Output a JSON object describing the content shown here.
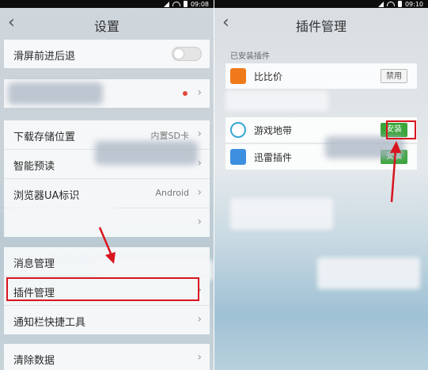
{
  "left": {
    "status_time": "09:08",
    "title": "设置",
    "back_glyph": "‹",
    "items": {
      "swipe": "滑屏前进后退",
      "download_location": "下载存储位置",
      "download_location_value": "内置SD卡",
      "smart_preread": "智能预读",
      "ua": "浏览器UA标识",
      "ua_value": "Android",
      "messages": "消息管理",
      "plugins": "插件管理",
      "notification_tool": "通知栏快捷工具",
      "clear_data": "清除数据"
    }
  },
  "right": {
    "status_time": "09:10",
    "title": "插件管理",
    "back_glyph": "‹",
    "section": "已安装插件",
    "plugins": [
      {
        "name": "比比价",
        "action": "禁用"
      },
      {
        "name": "游戏地带",
        "action": "安装"
      },
      {
        "name": "迅雷插件",
        "action": "安装"
      }
    ]
  },
  "colors": {
    "highlight": "#d8141e",
    "install_green": "#3aa53a",
    "dot_red": "#e04a3a"
  },
  "icons": {
    "back": "chevron-left-icon",
    "chevron": "chevron-right-icon",
    "arrow": "red-arrow-annotation"
  }
}
